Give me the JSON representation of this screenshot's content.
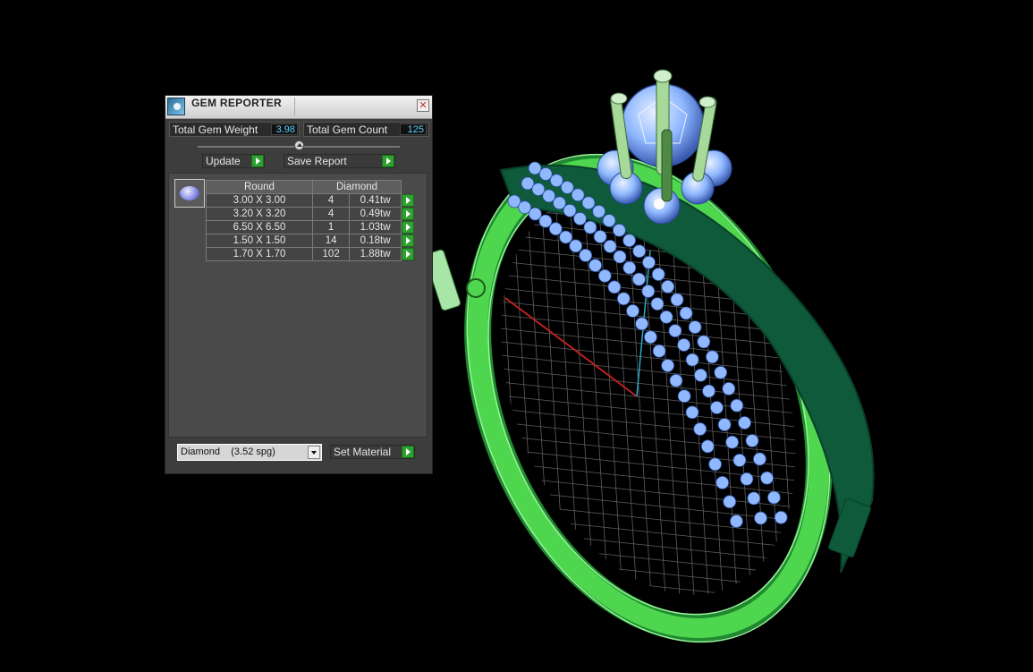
{
  "panel": {
    "title": "GEM REPORTER",
    "close_label": "✕",
    "total_weight_label": "Total Gem Weight",
    "total_weight_value": "3.98",
    "total_count_label": "Total Gem Count",
    "total_count_value": "125",
    "update_label": "Update",
    "save_report_label": "Save Report",
    "table": {
      "headers": [
        "Round",
        "Diamond"
      ],
      "rows": [
        {
          "size": "3.00 X 3.00",
          "count": "4",
          "weight": "0.41tw"
        },
        {
          "size": "3.20 X 3.20",
          "count": "4",
          "weight": "0.49tw"
        },
        {
          "size": "6.50 X 6.50",
          "count": "1",
          "weight": "1.03tw"
        },
        {
          "size": "1.50 X 1.50",
          "count": "14",
          "weight": "0.18tw"
        },
        {
          "size": "1.70 X 1.70",
          "count": "102",
          "weight": "1.88tw"
        }
      ]
    },
    "material_value": "Diamond    (3.52 spg)",
    "set_material_label": "Set Material"
  },
  "colors": {
    "band": "#4fd64f",
    "band_dark": "#0e5a3a",
    "gem": "#8fb8ff",
    "accent_value": "#5fd0ff"
  }
}
